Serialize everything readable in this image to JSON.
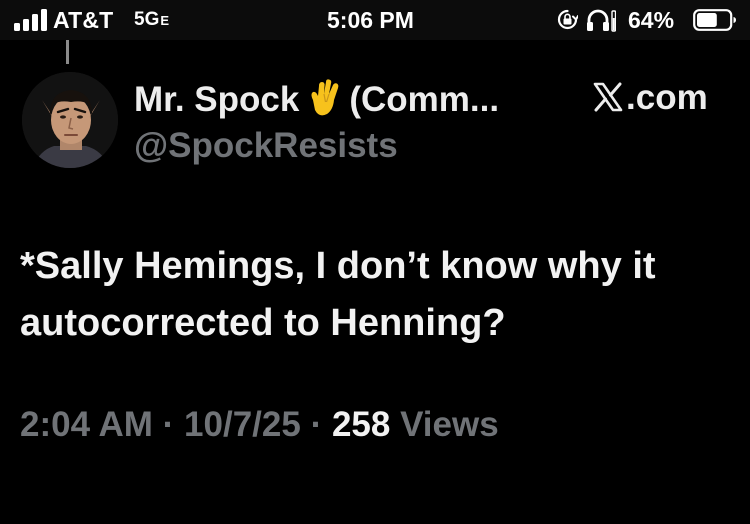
{
  "status_bar": {
    "carrier": "AT&T",
    "network": "5G",
    "network_suffix": "E",
    "time": "5:06 PM",
    "battery_percent": "64%",
    "battery_level": 0.64,
    "icons": [
      "signal-icon",
      "orientation-lock-icon",
      "headphones-icon",
      "battery-icon"
    ]
  },
  "tweet": {
    "display_name": "Mr. Spock",
    "display_name_suffix": "(Comm...",
    "display_name_emoji": "vulcan-salute-icon",
    "handle": "@SpockResists",
    "source": ".com",
    "source_icon": "x-logo-icon",
    "text": "*Sally Hemings, I don’t know why it autocorrected to Henning?",
    "time": "2:04 AM",
    "date": "10/7/25",
    "views_count": "258",
    "views_label": "Views",
    "separator": "·"
  },
  "colors": {
    "background": "#000000",
    "status_bar_bg": "#0c0c0c",
    "primary_text": "#f2f2f2",
    "secondary_text": "#707377",
    "emoji_yellow": "#f7c21c"
  }
}
